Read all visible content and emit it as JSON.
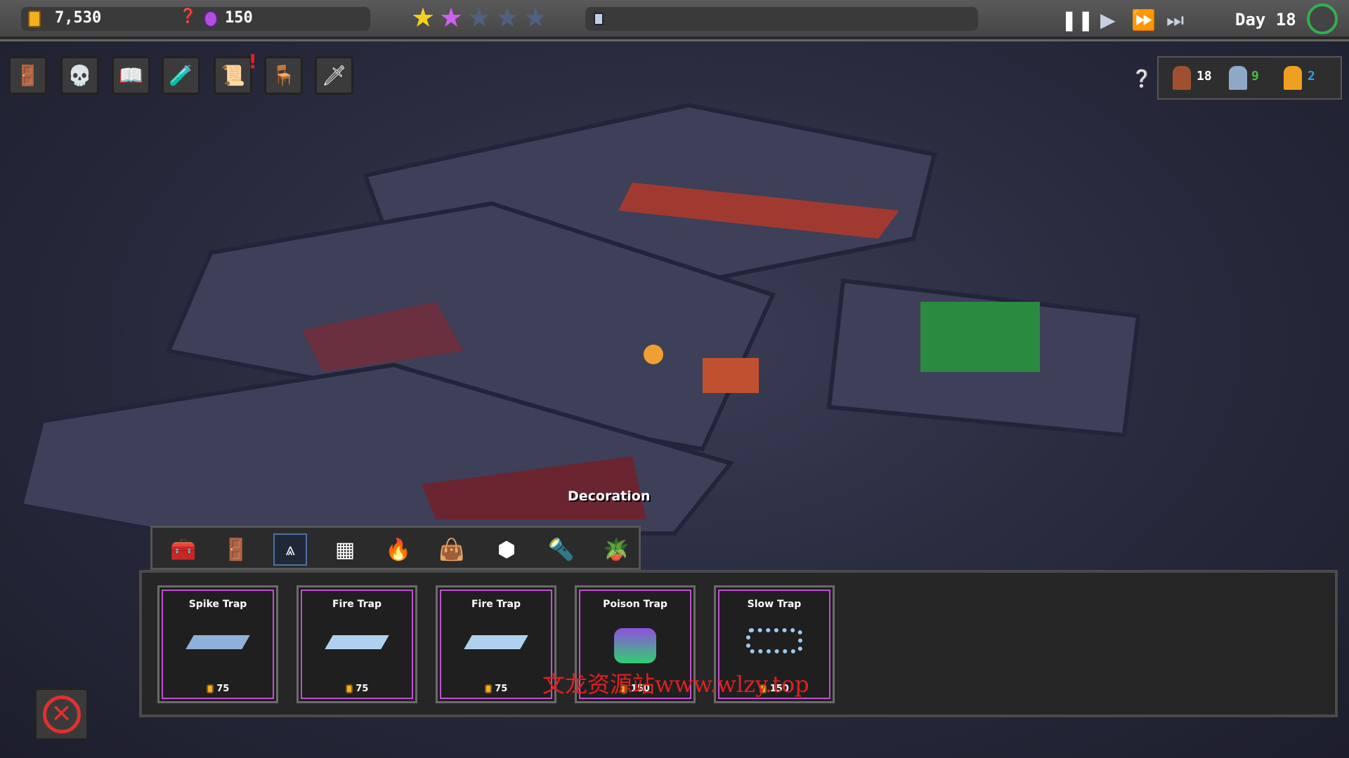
{
  "resources": {
    "gold": "7,530",
    "gems": "150"
  },
  "rating": {
    "filled": 2,
    "total": 5
  },
  "colors": {
    "gold_star": "#f5d020",
    "purple_star": "#d060f0",
    "empty_star": "#506080",
    "accent": "#c050d0"
  },
  "time": {
    "day_label": "Day 18",
    "controls": [
      "pause",
      "play",
      "fast-forward",
      "skip"
    ]
  },
  "toolbar": {
    "icons": [
      "portal",
      "skull",
      "spellbook",
      "ingredients",
      "quest-board",
      "throne",
      "hero"
    ]
  },
  "population": [
    {
      "count": "18",
      "color": "#ffffff"
    },
    {
      "count": "9",
      "color": "#40c040"
    },
    {
      "count": "2",
      "color": "#30a0e0"
    }
  ],
  "categories": {
    "icons": [
      "chest",
      "door",
      "trap",
      "tile",
      "fireplace",
      "sack",
      "pillar",
      "torch",
      "plant"
    ],
    "selected": 2
  },
  "hover_label": "Decoration",
  "cards": [
    {
      "name": "Spike Trap",
      "price": "75"
    },
    {
      "name": "Fire Trap",
      "price": "75"
    },
    {
      "name": "Fire Trap",
      "price": "75"
    },
    {
      "name": "Poison Trap",
      "price": "150"
    },
    {
      "name": "Slow Trap",
      "price": "150"
    }
  ],
  "watermark": "文龙资源站www.wlzy.top"
}
